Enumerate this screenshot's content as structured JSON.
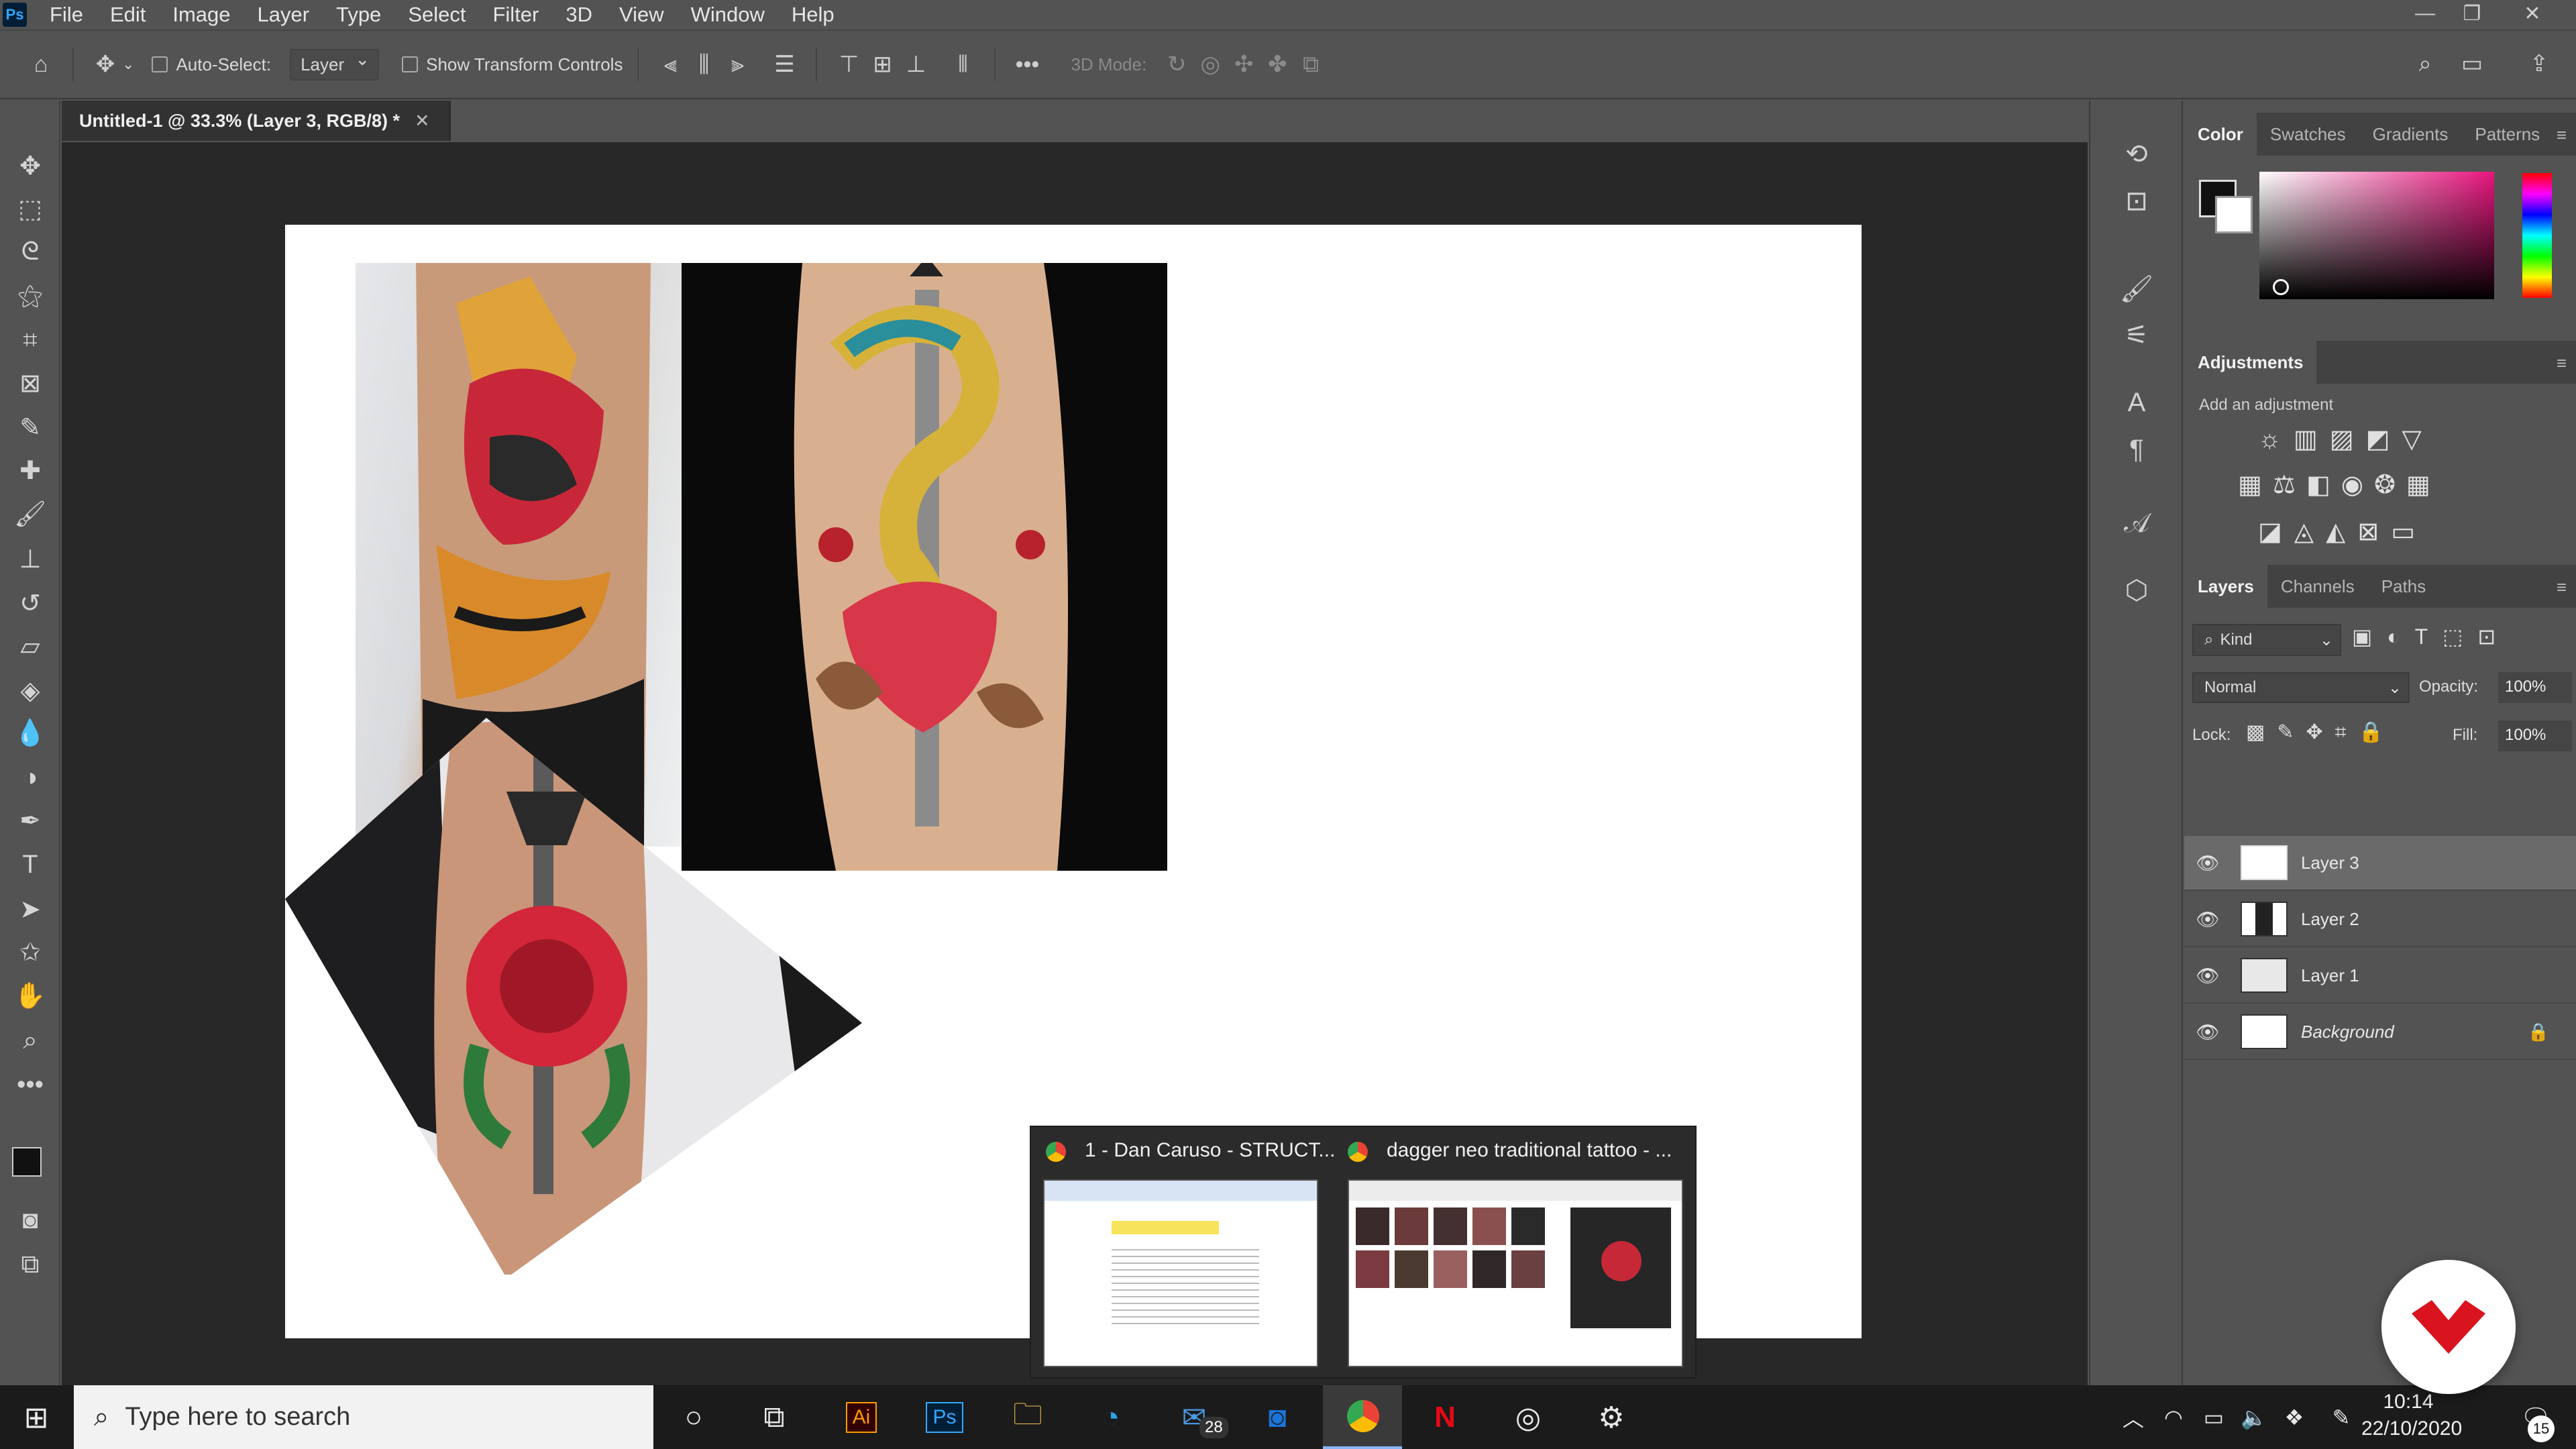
{
  "menubar": {
    "items": [
      "File",
      "Edit",
      "Image",
      "Layer",
      "Type",
      "Select",
      "Filter",
      "3D",
      "View",
      "Window",
      "Help"
    ]
  },
  "options": {
    "auto_select_label": "Auto-Select:",
    "auto_select_target": "Layer",
    "transform_label": "Show Transform Controls",
    "mode_3d_label": "3D Mode:"
  },
  "document": {
    "tab_title": "Untitled-1 @ 33.3% (Layer 3, RGB/8) *"
  },
  "panels": {
    "color_tabs": [
      "Color",
      "Swatches",
      "Gradients",
      "Patterns"
    ],
    "adjustments_title": "Adjustments",
    "adjustments_hint": "Add an adjustment",
    "layers_tabs": [
      "Layers",
      "Channels",
      "Paths"
    ],
    "filter_kind": "Kind",
    "blend_mode": "Normal",
    "opacity_label": "Opacity:",
    "opacity_value": "100%",
    "lock_label": "Lock:",
    "fill_label": "Fill:",
    "fill_value": "100%",
    "layers": [
      {
        "name": "Layer 3",
        "selected": true
      },
      {
        "name": "Layer 2",
        "selected": false
      },
      {
        "name": "Layer 1",
        "selected": false
      },
      {
        "name": "Background",
        "selected": false,
        "locked": true
      }
    ]
  },
  "popup": {
    "left_title": "1 - Dan Caruso - STRUCT...",
    "right_title": "dagger neo traditional tattoo - ..."
  },
  "taskbar": {
    "search_placeholder": "Type here to search",
    "mail_badge": "28",
    "time": "10:14",
    "date": "22/10/2020",
    "notification_count": "15",
    "ai_label": "Ai",
    "ps_label": "Ps"
  },
  "colors": {
    "ui_bg": "#535353",
    "doc_bg": "#282828",
    "ps_accent": "#31a8ff",
    "brand_red": "#d9141e"
  }
}
